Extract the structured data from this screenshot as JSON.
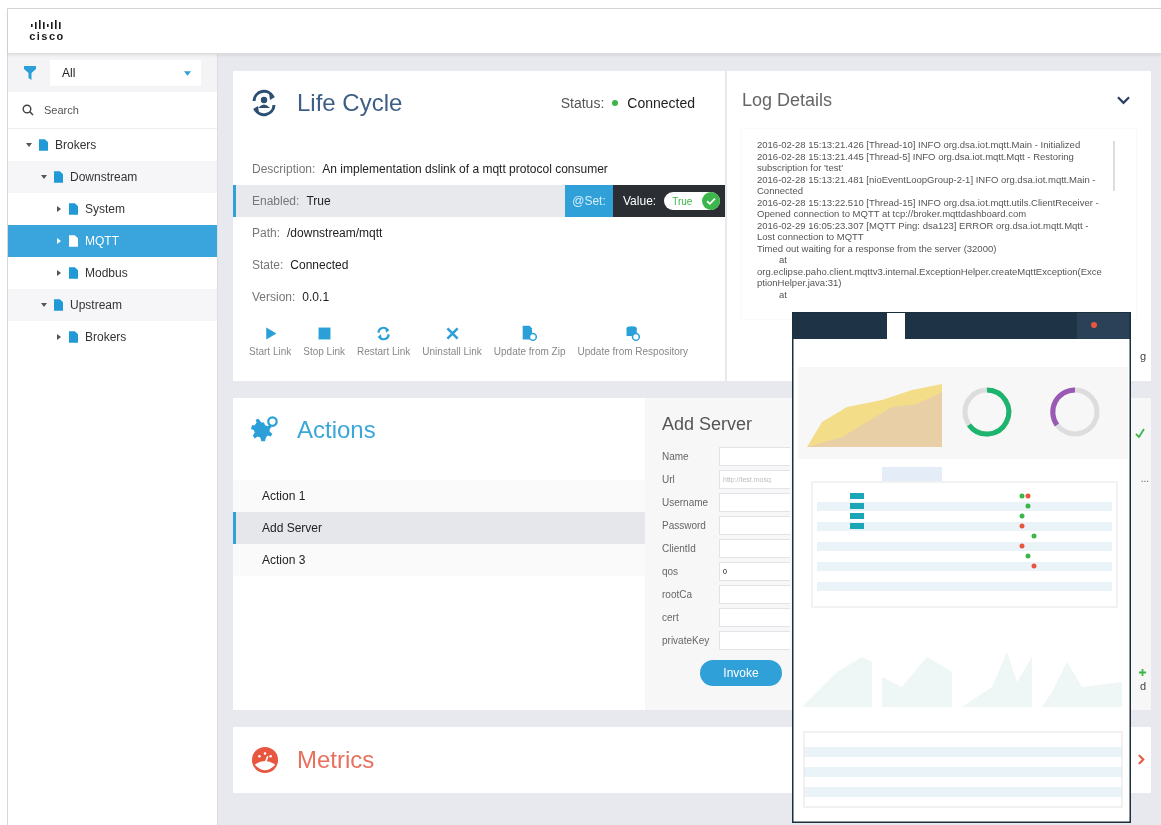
{
  "header": {
    "logo": "cisco"
  },
  "sidebar": {
    "filter": {
      "value": "All"
    },
    "search": {
      "placeholder": "Search"
    },
    "tree": [
      {
        "label": "Brokers",
        "expanded": true,
        "selected": false,
        "children": [
          {
            "label": "Downstream",
            "expanded": true,
            "selected": false,
            "children": [
              {
                "label": "System",
                "expanded": false,
                "selected": false
              },
              {
                "label": "MQTT",
                "expanded": false,
                "selected": true
              },
              {
                "label": "Modbus",
                "expanded": false,
                "selected": false
              }
            ]
          },
          {
            "label": "Upstream",
            "expanded": true,
            "selected": false,
            "children": [
              {
                "label": "Brokers",
                "expanded": false,
                "selected": false
              }
            ]
          }
        ]
      }
    ]
  },
  "lifecycle": {
    "title": "Life Cycle",
    "status_label": "Status:",
    "status": "Connected",
    "status_ok": true,
    "fields": [
      {
        "kind": "text",
        "label": "Description:",
        "value": "An implementation dslink of a mqtt protocol consumer"
      },
      {
        "kind": "switch",
        "label": "Enabled:",
        "value": "True",
        "set_label": "@Set:",
        "value_label": "Value:",
        "toggle": {
          "label": "True",
          "on": true
        }
      },
      {
        "kind": "text",
        "label": "Path:",
        "value": "/downstream/mqtt"
      },
      {
        "kind": "text",
        "label": "State:",
        "value": "Connected"
      },
      {
        "kind": "text",
        "label": "Version:",
        "value": "0.0.1"
      }
    ],
    "tools": [
      "Start Link",
      "Stop Link",
      "Restart Link",
      "Uninstall Link",
      "Update from Zip",
      "Update from Respository"
    ]
  },
  "log": {
    "title": "Log Details",
    "lines": [
      {
        "kind": "entry",
        "text": "2016-02-28 15:13:21.426 [Thread-10] INFO org.dsa.iot.mqtt.Main - Initialized"
      },
      {
        "kind": "entry",
        "text": "2016-02-28 15:13:21.445 [Thread-5] INFO org.dsa.iot.mqtt.Mqtt - Restoring subscription for 'test'"
      },
      {
        "kind": "entry",
        "text": "2016-02-28 15:13:21.481 [nioEventLoopGroup-2-1] INFO org.dsa.iot.mqtt.Main - Connected"
      },
      {
        "kind": "entry",
        "text": "2016-02-28 15:13:22.510 [Thread-15] INFO org.dsa.iot.mqtt.utils.ClientReceiver - Opened connection to MQTT at tcp://broker.mqttdashboard.com"
      },
      {
        "kind": "entry",
        "text": "2016-02-29 16:05:23.307 [MQTT Ping: dsa123] ERROR org.dsa.iot.mqtt.Mqtt - Lost connection to MQTT"
      },
      {
        "kind": "entry",
        "text": "Timed out waiting for a response from the server (32000)"
      },
      {
        "kind": "trace",
        "text": "at"
      },
      {
        "kind": "entry",
        "text": "org.eclipse.paho.client.mqttv3.internal.ExceptionHelper.createMqttException(ExceptionHelper.java:31)"
      },
      {
        "kind": "trace",
        "text": "at"
      }
    ],
    "fragment": "g"
  },
  "actions": {
    "title": "Actions",
    "items": [
      {
        "label": "Action 1",
        "selected": false
      },
      {
        "label": "Add Server",
        "selected": true
      },
      {
        "label": "Action 3",
        "selected": false
      }
    ],
    "form": {
      "title": "Add Server",
      "fields": [
        {
          "label": "Name"
        },
        {
          "label": "Url",
          "placeholder": "http://test.mosq"
        },
        {
          "label": "Username"
        },
        {
          "label": "Password"
        },
        {
          "label": "ClientId"
        },
        {
          "label": "qos",
          "value": "0"
        },
        {
          "label": "rootCa"
        },
        {
          "label": "cert"
        },
        {
          "label": "privateKey"
        }
      ],
      "invoke": "Invoke",
      "fragments": [
        "...",
        "d"
      ]
    }
  },
  "metrics": {
    "title": "Metrics"
  }
}
